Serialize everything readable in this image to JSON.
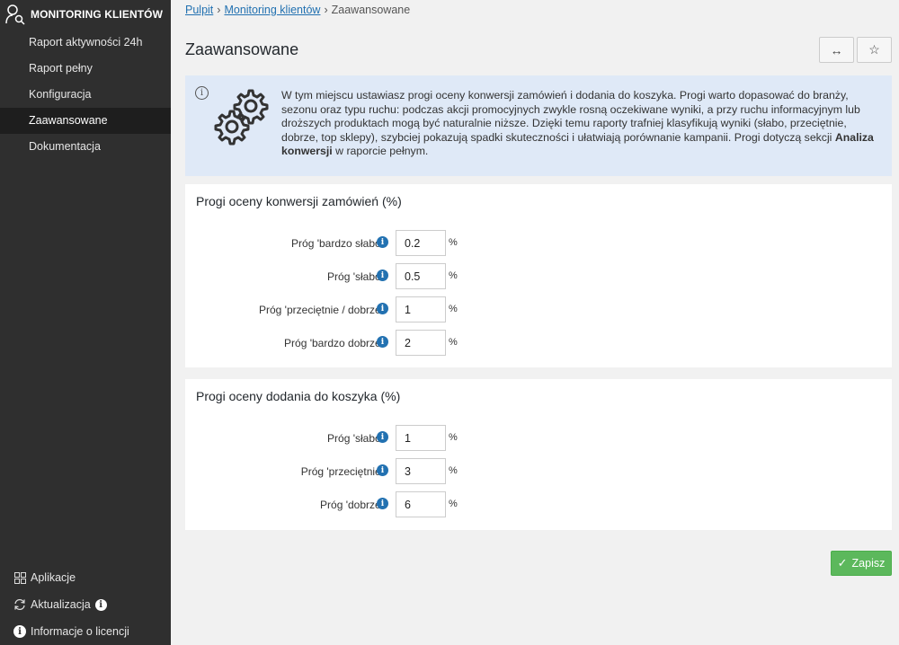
{
  "sidebar": {
    "brand": "MONITORING KLIENTÓW",
    "items": [
      {
        "label": "Raport aktywności 24h"
      },
      {
        "label": "Raport pełny"
      },
      {
        "label": "Konfiguracja"
      },
      {
        "label": "Zaawansowane",
        "active": true
      },
      {
        "label": "Dokumentacja"
      }
    ],
    "bottom": {
      "apps": "Aplikacje",
      "updates": "Aktualizacja",
      "license": "Informacje o licencji"
    }
  },
  "breadcrumb": {
    "home": "Pulpit",
    "section": "Monitoring klientów",
    "current": "Zaawansowane",
    "separator": "›"
  },
  "page": {
    "title": "Zaawansowane",
    "expand_icon": "↔",
    "star_icon": "☆"
  },
  "notice": {
    "text_before": "W tym miejscu ustawiasz progi oceny konwersji zamówień i dodania do koszyka. Progi warto dopasować do branży, sezonu oraz typu ruchu: podczas akcji promocyjnych zwykle rosną oczekiwane wyniki, a przy ruchu informacyjnym lub droższych produktach mogą być naturalnie niższe. Dzięki temu raporty trafniej klasyfikują wyniki (słabo, przeciętnie, dobrze, top sklepy), szybciej pokazują spadki skuteczności i ułatwiają porównanie kampanii. Progi dotyczą sekcji ",
    "bold": "Analiza konwersji",
    "text_after": " w raporcie pełnym."
  },
  "orders": {
    "title": "Progi oceny konwersji zamówień (%)",
    "fields": [
      {
        "label": "Próg 'bardzo słabo'",
        "value": "0.2",
        "unit": "%"
      },
      {
        "label": "Próg 'słabo'",
        "value": "0.5",
        "unit": "%"
      },
      {
        "label": "Próg 'przeciętnie / dobrze'",
        "value": "1",
        "unit": "%"
      },
      {
        "label": "Próg 'bardzo dobrze'",
        "value": "2",
        "unit": "%"
      }
    ]
  },
  "cart": {
    "title": "Progi oceny dodania do koszyka (%)",
    "fields": [
      {
        "label": "Próg 'słabo'",
        "value": "1",
        "unit": "%"
      },
      {
        "label": "Próg 'przeciętnie'",
        "value": "3",
        "unit": "%"
      },
      {
        "label": "Próg 'dobrze'",
        "value": "6",
        "unit": "%"
      }
    ]
  },
  "actions": {
    "save": "Zapisz"
  },
  "colors": {
    "sidebar": "#2f2f2f",
    "accent": "#2271b1",
    "save": "#5cb85c",
    "notice": "#dfe9f7"
  }
}
